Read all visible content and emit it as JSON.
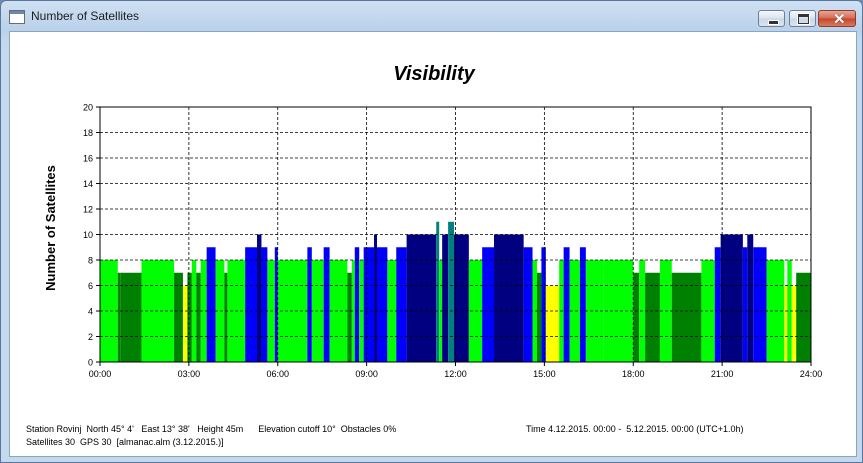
{
  "window": {
    "title": "Number of Satellites",
    "min_label": "minimize",
    "max_label": "maximize",
    "close_label": "close"
  },
  "chart_data": {
    "type": "bar",
    "title": "Visibility",
    "ylabel": "Number of Satellites",
    "xlabel": "",
    "ylim": [
      0,
      20
    ],
    "xlim_hours": [
      0,
      24
    ],
    "yticks": [
      "0",
      "2",
      "4",
      "6",
      "8",
      "10",
      "12",
      "14",
      "16",
      "18",
      "20"
    ],
    "xticks": [
      "00:00",
      "03:00",
      "06:00",
      "09:00",
      "12:00",
      "15:00",
      "18:00",
      "21:00",
      "24:00"
    ],
    "grid": true,
    "colors": {
      "6": "#ffff00",
      "7": "#008000",
      "8": "#00ff00",
      "9": "#0000ff",
      "10": "#000080",
      "11": "#008080"
    },
    "segments": [
      [
        0.0,
        0.6,
        8
      ],
      [
        0.6,
        0.7,
        7
      ],
      [
        0.7,
        1.4,
        7
      ],
      [
        1.4,
        2.5,
        8
      ],
      [
        2.5,
        2.8,
        7
      ],
      [
        2.8,
        2.95,
        6
      ],
      [
        2.95,
        3.1,
        7
      ],
      [
        3.1,
        3.25,
        8
      ],
      [
        3.25,
        3.4,
        7
      ],
      [
        3.4,
        3.6,
        8
      ],
      [
        3.6,
        3.9,
        9
      ],
      [
        3.9,
        4.2,
        8
      ],
      [
        4.2,
        4.3,
        7
      ],
      [
        4.3,
        4.9,
        8
      ],
      [
        4.9,
        5.3,
        9
      ],
      [
        5.3,
        5.45,
        10
      ],
      [
        5.45,
        5.65,
        9
      ],
      [
        5.65,
        5.9,
        8
      ],
      [
        5.9,
        6.0,
        9
      ],
      [
        6.0,
        7.0,
        8
      ],
      [
        7.0,
        7.15,
        9
      ],
      [
        7.15,
        7.55,
        8
      ],
      [
        7.55,
        7.75,
        9
      ],
      [
        7.75,
        8.35,
        8
      ],
      [
        8.35,
        8.5,
        7
      ],
      [
        8.5,
        8.6,
        8
      ],
      [
        8.6,
        8.75,
        9
      ],
      [
        8.75,
        8.9,
        8
      ],
      [
        8.9,
        9.25,
        9
      ],
      [
        9.25,
        9.35,
        10
      ],
      [
        9.35,
        9.7,
        9
      ],
      [
        9.7,
        10.0,
        8
      ],
      [
        10.0,
        10.35,
        9
      ],
      [
        10.35,
        11.35,
        10
      ],
      [
        11.35,
        11.45,
        11
      ],
      [
        11.45,
        11.55,
        8
      ],
      [
        11.55,
        11.75,
        10
      ],
      [
        11.75,
        11.95,
        11
      ],
      [
        11.95,
        12.45,
        10
      ],
      [
        12.45,
        12.9,
        8
      ],
      [
        12.9,
        13.3,
        9
      ],
      [
        13.3,
        14.3,
        10
      ],
      [
        14.3,
        14.6,
        9
      ],
      [
        14.6,
        14.75,
        8
      ],
      [
        14.75,
        14.9,
        7
      ],
      [
        14.9,
        15.05,
        9
      ],
      [
        15.05,
        15.5,
        6
      ],
      [
        15.5,
        15.65,
        8
      ],
      [
        15.65,
        15.85,
        9
      ],
      [
        15.85,
        16.2,
        8
      ],
      [
        16.2,
        16.4,
        9
      ],
      [
        16.4,
        17.0,
        8
      ],
      [
        17.0,
        18.0,
        8
      ],
      [
        18.0,
        18.2,
        7
      ],
      [
        18.2,
        18.4,
        8
      ],
      [
        18.4,
        18.9,
        7
      ],
      [
        18.9,
        19.3,
        8
      ],
      [
        19.3,
        20.3,
        7
      ],
      [
        20.3,
        20.75,
        8
      ],
      [
        20.75,
        20.95,
        9
      ],
      [
        20.95,
        21.7,
        10
      ],
      [
        21.7,
        21.85,
        9
      ],
      [
        21.85,
        22.05,
        10
      ],
      [
        22.05,
        22.5,
        9
      ],
      [
        22.5,
        23.1,
        8
      ],
      [
        23.1,
        23.2,
        6
      ],
      [
        23.2,
        23.35,
        8
      ],
      [
        23.35,
        23.5,
        6
      ],
      [
        23.5,
        24.0,
        7
      ]
    ]
  },
  "footer": {
    "station_line": "Station Rovinj  North 45° 4'   East 13° 38'   Height 45m      Elevation cutoff 10°  Obstacles 0%",
    "sat_line": "Satellites 30  GPS 30  [almanac.alm (3.12.2015.)]",
    "time_line": "Time 4.12.2015. 00:00 -  5.12.2015. 00:00 (UTC+1.0h)"
  }
}
